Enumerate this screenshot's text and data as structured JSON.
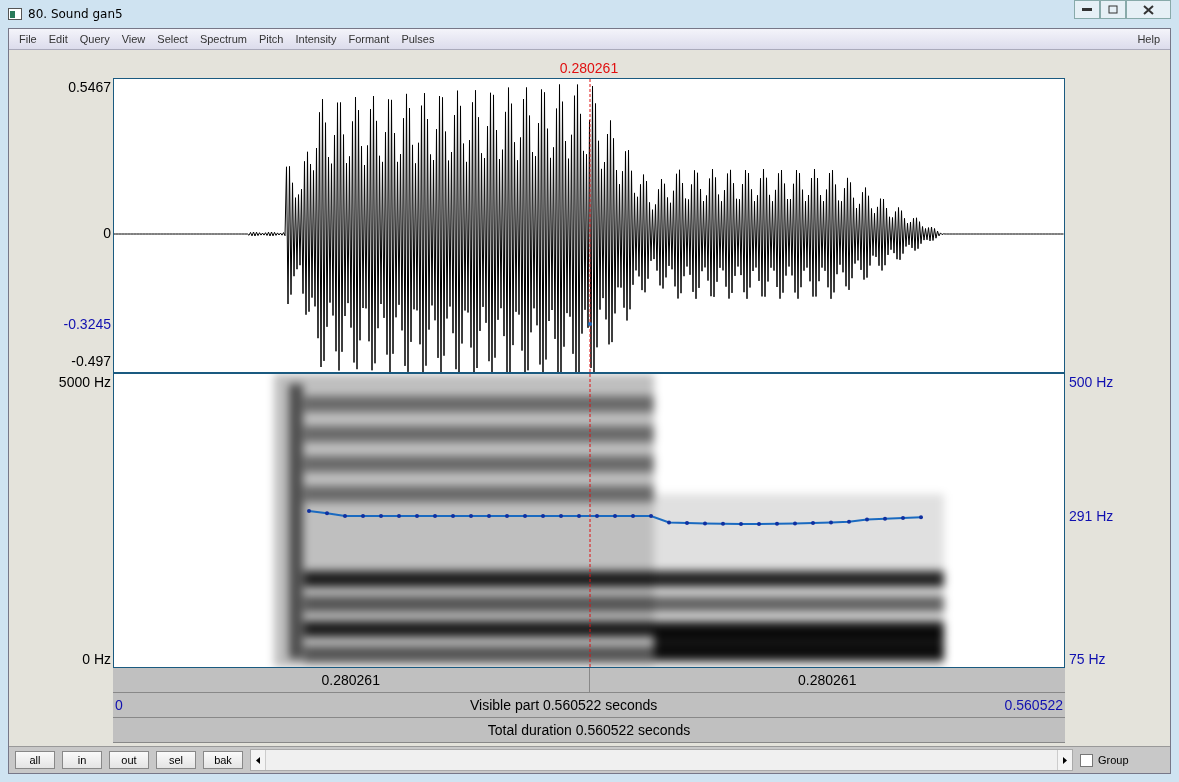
{
  "window": {
    "title": "80. Sound gan5"
  },
  "menu": [
    "File",
    "Edit",
    "Query",
    "View",
    "Select",
    "Spectrum",
    "Pitch",
    "Intensity",
    "Formant",
    "Pulses"
  ],
  "help": "Help",
  "cursor": {
    "time": "0.280261"
  },
  "waveform": {
    "labels": [
      {
        "text": "0.5467",
        "color": "#000000"
      },
      {
        "text": "0",
        "color": "#000000"
      },
      {
        "text": "-0.3245",
        "color": "#1010b0"
      },
      {
        "text": "-0.497",
        "color": "#000000"
      }
    ]
  },
  "spectrogram": {
    "left_labels": [
      "5000 Hz",
      "0 Hz"
    ],
    "right_labels": [
      "500 Hz",
      "291 Hz",
      "75 Hz"
    ]
  },
  "time_row": [
    "0.280261",
    "0.280261"
  ],
  "visible": {
    "start": "0",
    "text": "Visible part 0.560522 seconds",
    "end": "0.560522"
  },
  "total": "Total duration 0.560522 seconds",
  "buttons": [
    "all",
    "in",
    "out",
    "sel",
    "bak"
  ],
  "group": {
    "label": "Group",
    "checked": false
  }
}
